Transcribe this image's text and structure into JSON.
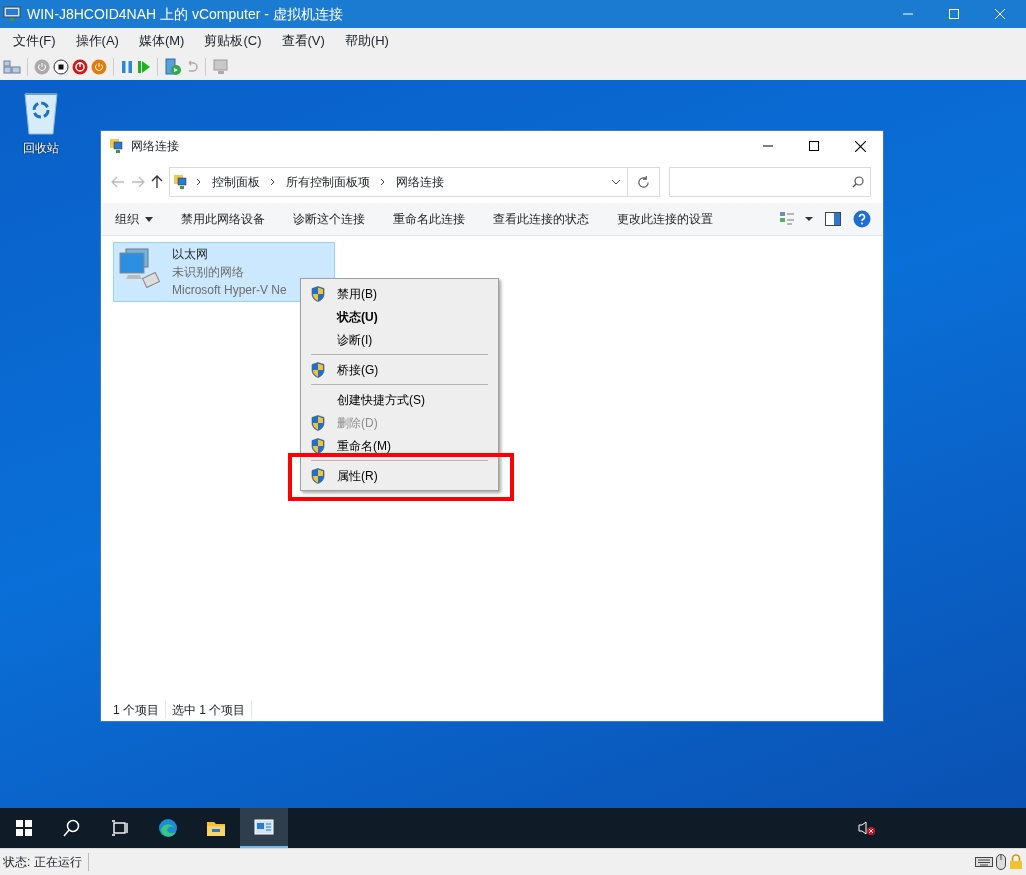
{
  "window": {
    "title": "WIN-J8HCOID4NAH 上的 vComputer - 虚拟机连接"
  },
  "menu": [
    "文件(F)",
    "操作(A)",
    "媒体(M)",
    "剪贴板(C)",
    "查看(V)",
    "帮助(H)"
  ],
  "desktop": {
    "icons": [
      {
        "label": "回收站"
      }
    ]
  },
  "explorer": {
    "title": "网络连接",
    "breadcrumb": [
      "控制面板",
      "所有控制面板项",
      "网络连接"
    ],
    "commands": [
      {
        "label": "组织",
        "dropdown": true
      },
      {
        "label": "禁用此网络设备",
        "dropdown": false
      },
      {
        "label": "诊断这个连接",
        "dropdown": false
      },
      {
        "label": "重命名此连接",
        "dropdown": false
      },
      {
        "label": "查看此连接的状态",
        "dropdown": false
      },
      {
        "label": "更改此连接的设置",
        "dropdown": false
      }
    ],
    "items": [
      {
        "name": "以太网",
        "status": "未识别的网络",
        "device": "Microsoft Hyper-V Ne",
        "selected": true
      }
    ],
    "status_bar": [
      "1 个项目",
      "选中 1 个项目"
    ]
  },
  "context_menu": {
    "items": [
      {
        "kind": "item",
        "label": "禁用(B)",
        "shield": true,
        "bold": false,
        "disabled": false,
        "highlighted": false
      },
      {
        "kind": "item",
        "label": "状态(U)",
        "shield": false,
        "bold": true,
        "disabled": false,
        "highlighted": false
      },
      {
        "kind": "item",
        "label": "诊断(I)",
        "shield": false,
        "bold": false,
        "disabled": false,
        "highlighted": false
      },
      {
        "kind": "separator"
      },
      {
        "kind": "item",
        "label": "桥接(G)",
        "shield": true,
        "bold": false,
        "disabled": false,
        "highlighted": false
      },
      {
        "kind": "separator"
      },
      {
        "kind": "item",
        "label": "创建快捷方式(S)",
        "shield": false,
        "bold": false,
        "disabled": false,
        "highlighted": false
      },
      {
        "kind": "item",
        "label": "删除(D)",
        "shield": true,
        "bold": false,
        "disabled": true,
        "highlighted": false
      },
      {
        "kind": "item",
        "label": "重命名(M)",
        "shield": true,
        "bold": false,
        "disabled": false,
        "highlighted": false
      },
      {
        "kind": "separator"
      },
      {
        "kind": "item",
        "label": "属性(R)",
        "shield": true,
        "bold": false,
        "disabled": false,
        "highlighted": true
      }
    ]
  },
  "taskbar": [
    {
      "kind": "start",
      "active": false
    },
    {
      "kind": "search",
      "active": false
    },
    {
      "kind": "taskview",
      "active": false
    },
    {
      "kind": "browser",
      "active": false
    },
    {
      "kind": "folder",
      "active": false
    },
    {
      "kind": "vm",
      "active": true
    }
  ],
  "status": "状态: 正在运行"
}
